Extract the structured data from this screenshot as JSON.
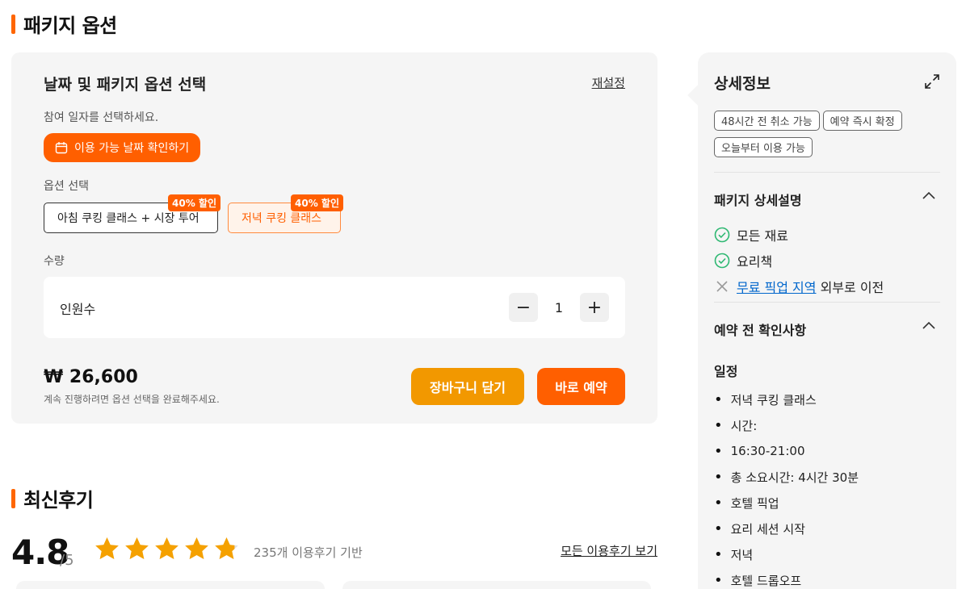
{
  "package_section": {
    "title": "패키지 옵션"
  },
  "selector": {
    "title": "날짜 및 패키지 옵션 선택",
    "reset_label": "재설정",
    "date_prompt": "참여 일자를 선택하세요.",
    "date_button_label": "이용 가능 날짜 확인하기",
    "option_label": "옵션 선택",
    "options": [
      {
        "label": "아침 쿠킹 클래스 + 시장 투어",
        "badge": "40% 할인",
        "selected": false
      },
      {
        "label": "저녁 쿠킹 클래스",
        "badge": "40% 할인",
        "selected": true
      }
    ],
    "quantity_label": "수량",
    "quantity_row_label": "인원수",
    "quantity_value": "1",
    "minus": "−",
    "plus": "+",
    "price": "₩ 26,600",
    "price_note": "계속 진행하려면 옵션 선택을 완료해주세요.",
    "cart_button": "장바구니 담기",
    "buy_button": "바로 예약"
  },
  "reviews": {
    "title": "최신후기",
    "rating": "4.8",
    "rating_max": "/5",
    "stars": 4.8,
    "count_text": "235개 이용후기 기반",
    "all_reviews_link": "모든 이용후기 보기"
  },
  "details": {
    "title": "상세정보",
    "tags": [
      "48시간 전 취소 가능",
      "예약 즉시 확정",
      "오늘부터 이용 가능"
    ],
    "package_desc_title": "패키지 상세설명",
    "included": [
      "모든 재료",
      "요리책"
    ],
    "excluded_link": "무료 픽업 지역",
    "excluded_rest": " 외부로 이전",
    "prebook_title": "예약 전 확인사항",
    "schedule_title": "일정",
    "schedule": [
      "저녁 쿠킹 클래스",
      "시간:",
      "16:30-21:00",
      "총 소요시간: 4시간 30분",
      "호텔 픽업",
      "요리 세션 시작",
      "저녁",
      "호텔 드롭오프"
    ]
  },
  "colors": {
    "accent": "#ff5f00",
    "cart": "#f29800",
    "star": "#f5a100",
    "check": "#2eb872"
  }
}
